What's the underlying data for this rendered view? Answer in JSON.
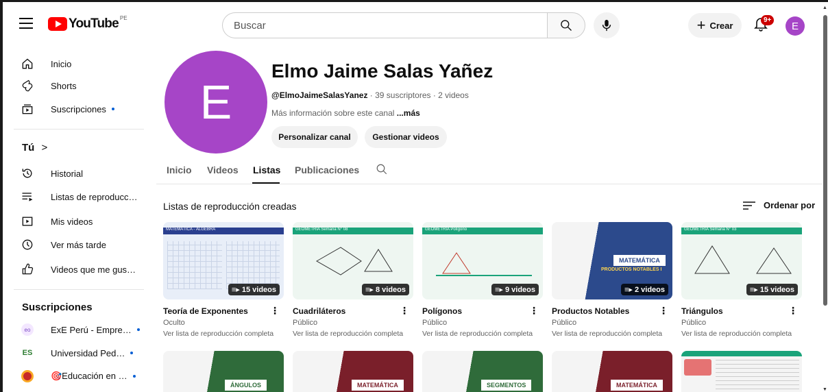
{
  "header": {
    "logo_text": "YouTube",
    "country_code": "PE",
    "search_placeholder": "Buscar",
    "create_label": "Crear",
    "notif_badge": "9+",
    "avatar_letter": "E"
  },
  "sidebar": {
    "main": [
      {
        "label": "Inicio",
        "icon": "home-icon"
      },
      {
        "label": "Shorts",
        "icon": "shorts-icon"
      },
      {
        "label": "Suscripciones",
        "icon": "subscriptions-icon",
        "dot": true
      }
    ],
    "you_title": "Tú",
    "you_items": [
      {
        "label": "Historial",
        "icon": "history-icon"
      },
      {
        "label": "Listas de reproducc…",
        "icon": "playlists-icon"
      },
      {
        "label": "Mis videos",
        "icon": "my-videos-icon"
      },
      {
        "label": "Ver más tarde",
        "icon": "watch-later-icon"
      },
      {
        "label": "Videos que me gus…",
        "icon": "liked-icon"
      }
    ],
    "subs_title": "Suscripciones",
    "subs": [
      {
        "label": "ExE Perú - Empre…",
        "color": "#e0e0e0"
      },
      {
        "label": "Universidad Ped…",
        "color": "#2e7d32"
      },
      {
        "label": "🎯Educación en …",
        "color": "#c62828"
      }
    ]
  },
  "channel": {
    "avatar_letter": "E",
    "name": "Elmo Jaime Salas Yañez",
    "handle": "@ElmoJaimeSalasYanez",
    "stats": " · 39 suscriptores · 2 videos",
    "more_info": "Más información sobre este canal ",
    "more_link": "...más",
    "btn_customize": "Personalizar canal",
    "btn_manage": "Gestionar videos",
    "tabs": [
      "Inicio",
      "Videos",
      "Listas",
      "Publicaciones"
    ],
    "active_tab": "Listas"
  },
  "playlists": {
    "section_title": "Listas de reproducción creadas",
    "sort_label": "Ordenar por",
    "items": [
      {
        "title": "Teoría de Exponentes",
        "visibility": "Oculto",
        "count": "15 videos",
        "link": "Ver lista de reproducción completa",
        "bg": "#e8eef8",
        "band": "#2a3f8f",
        "band_text": "MATEMÁTICA - ÁLGEBRA"
      },
      {
        "title": "Cuadriláteros",
        "visibility": "Público",
        "count": "8 videos",
        "link": "Ver lista de reproducción completa",
        "bg": "#eef6f1",
        "band": "#1aa37a",
        "band_text": "GEOMETRÍA Semana N° 08"
      },
      {
        "title": "Polígonos",
        "visibility": "Público",
        "count": "9 videos",
        "link": "Ver lista de reproducción completa",
        "bg": "#eef6f1",
        "band": "#1aa37a",
        "band_text": "GEOMETRÍA Polígono"
      },
      {
        "title": "Productos Notables",
        "visibility": "Público",
        "count": "2 videos",
        "link": "Ver lista de reproducción completa",
        "bg": "#2c4a8c",
        "band": "#2c4a8c",
        "band_text": "MATEMÁTICA",
        "subtitle": "PRODUCTOS NOTABLES I"
      },
      {
        "title": "Triángulos",
        "visibility": "Público",
        "count": "15 videos",
        "link": "Ver lista de reproducción completa",
        "bg": "#eef6f1",
        "band": "#1aa37a",
        "band_text": "GEOMETRÍA Semana N° 03"
      }
    ],
    "row2": [
      {
        "bg": "#2f6b3a",
        "tag": "ÁNGULOS"
      },
      {
        "bg": "#7a1f2a",
        "tag": "MATEMÁTICA"
      },
      {
        "bg": "#2f6b3a",
        "tag": "SEGMENTOS"
      },
      {
        "bg": "#7a1f2a",
        "tag": "MATEMÁTICA"
      },
      {
        "bg": "#1aa37a",
        "tag": ""
      }
    ]
  }
}
